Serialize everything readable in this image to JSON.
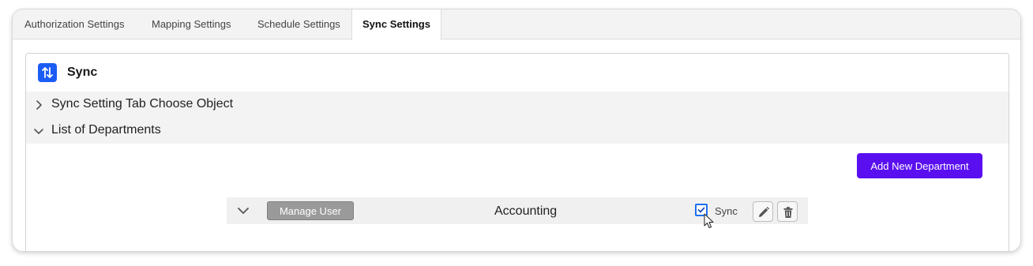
{
  "tabs": [
    {
      "label": "Authorization Settings"
    },
    {
      "label": "Mapping Settings"
    },
    {
      "label": "Schedule Settings"
    },
    {
      "label": "Sync Settings"
    }
  ],
  "card": {
    "title": "Sync",
    "icon": "sync-arrows-icon",
    "accent": "#1b5cf5"
  },
  "sections": [
    {
      "label": "Sync Setting Tab Choose Object",
      "expanded": false
    },
    {
      "label": "List of Departments",
      "expanded": true
    }
  ],
  "add_button": {
    "label": "Add New Department",
    "color": "#5a0ff0"
  },
  "departments": [
    {
      "manage_label": "Manage User",
      "name": "Accounting",
      "sync_label": "Sync",
      "sync_checked": true
    }
  ]
}
